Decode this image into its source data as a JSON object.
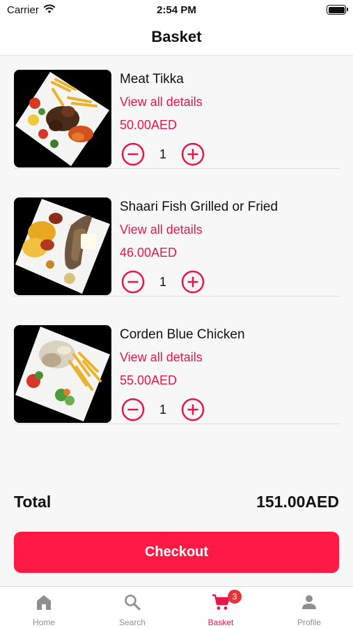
{
  "status_bar": {
    "carrier": "Carrier",
    "time": "2:54 PM"
  },
  "header": {
    "title": "Basket"
  },
  "basket": {
    "items": [
      {
        "name": "Meat Tikka",
        "details_link": "View all details",
        "price": "50.00AED",
        "quantity": "1"
      },
      {
        "name": "Shaari Fish Grilled or Fried",
        "details_link": "View all details",
        "price": "46.00AED",
        "quantity": "1"
      },
      {
        "name": "Corden Blue Chicken",
        "details_link": "View all details",
        "price": "55.00AED",
        "quantity": "1"
      }
    ]
  },
  "summary": {
    "total_label": "Total",
    "total_value": "151.00AED"
  },
  "checkout": {
    "label": "Checkout"
  },
  "tab_bar": {
    "tabs": [
      {
        "label": "Home",
        "icon": "home-icon"
      },
      {
        "label": "Search",
        "icon": "search-icon"
      },
      {
        "label": "Basket",
        "icon": "cart-icon",
        "badge": "3",
        "active": true
      },
      {
        "label": "Profile",
        "icon": "profile-icon"
      }
    ]
  },
  "colors": {
    "accent": "#e8174a",
    "button": "#fe1a45",
    "badge": "#e8333a",
    "inactive_tab": "#8e8e8e"
  }
}
